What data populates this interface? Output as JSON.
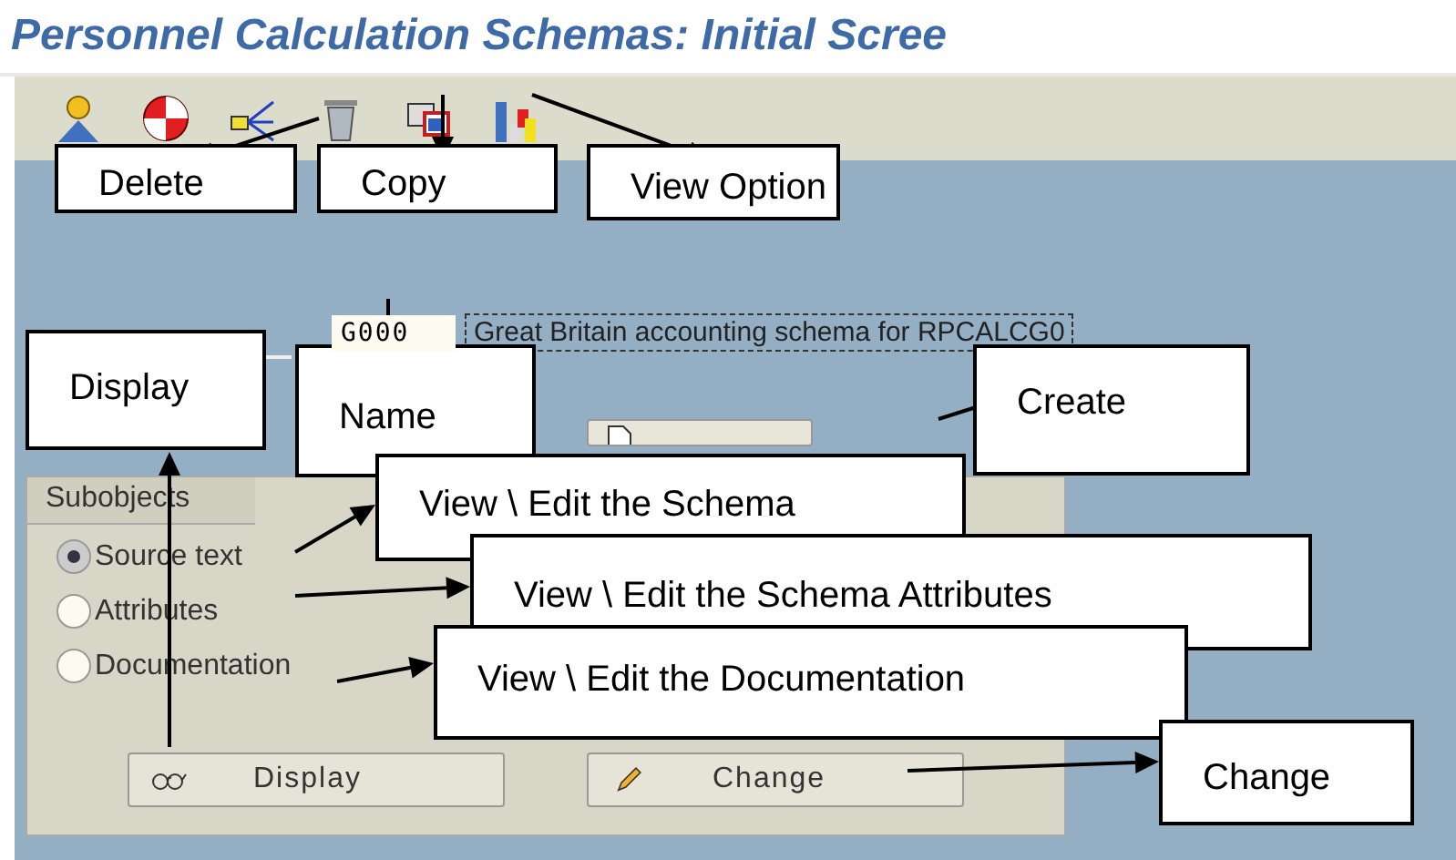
{
  "window": {
    "title": "Personnel Calculation Schemas: Initial Scree"
  },
  "schema": {
    "value": "G000",
    "description": "Great Britain accounting schema for RPCALCG0"
  },
  "subobjects": {
    "tab": "Subobjects",
    "options": [
      {
        "label": "Source text",
        "selected": true
      },
      {
        "label": "Attributes",
        "selected": false
      },
      {
        "label": "Documentation",
        "selected": false
      }
    ]
  },
  "buttons": [
    "Display",
    "Change"
  ],
  "annotations": [
    {
      "text": "Delete"
    },
    {
      "text": "Copy"
    },
    {
      "text": "View Option"
    },
    {
      "text": "Display"
    },
    {
      "text": "Name"
    },
    {
      "text": "Create"
    },
    {
      "text": "View \\ Edit the Schema"
    },
    {
      "text": "View \\ Edit the Schema Attributes"
    },
    {
      "text": "View \\ Edit the Documentation"
    },
    {
      "text": "Change"
    }
  ]
}
